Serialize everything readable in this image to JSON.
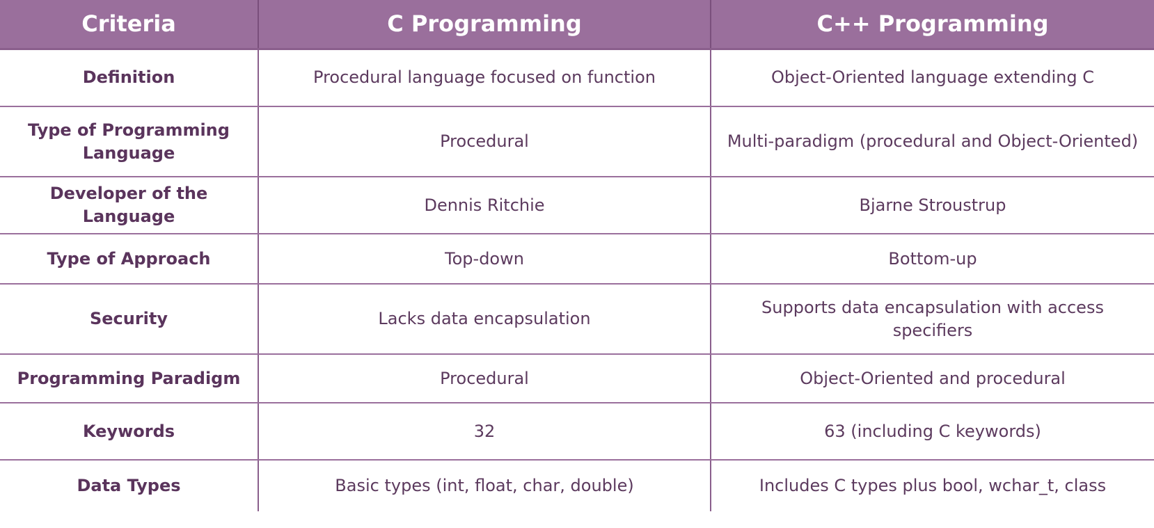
{
  "table": {
    "headers": [
      "Criteria",
      "C Programming",
      "C++ Programming"
    ],
    "rows": [
      {
        "criteria": "Definition",
        "c": "Procedural language focused on function",
        "cpp": "Object-Oriented language extending C"
      },
      {
        "criteria": "Type of Programming Language",
        "c": "Procedural",
        "cpp": "Multi-paradigm (procedural and Object-Oriented)"
      },
      {
        "criteria": "Developer of the Language",
        "c": "Dennis Ritchie",
        "cpp": "Bjarne Stroustrup"
      },
      {
        "criteria": "Type of Approach",
        "c": "Top-down",
        "cpp": "Bottom-up"
      },
      {
        "criteria": "Security",
        "c": "Lacks data encapsulation",
        "cpp": "Supports data encapsulation with access specifiers"
      },
      {
        "criteria": "Programming Paradigm",
        "c": "Procedural",
        "cpp": "Object-Oriented and procedural"
      },
      {
        "criteria": "Keywords",
        "c": "32",
        "cpp": "63 (including C keywords)"
      },
      {
        "criteria": "Data Types",
        "c": "Basic types (int, float, char, double)",
        "cpp": "Includes C types plus bool, wchar_t, class"
      }
    ]
  },
  "colors": {
    "header_background": "#9a6f9c",
    "header_text": "#ffffff",
    "body_text": "#5c3a5e",
    "grid_lines": "#9a6f9c"
  }
}
